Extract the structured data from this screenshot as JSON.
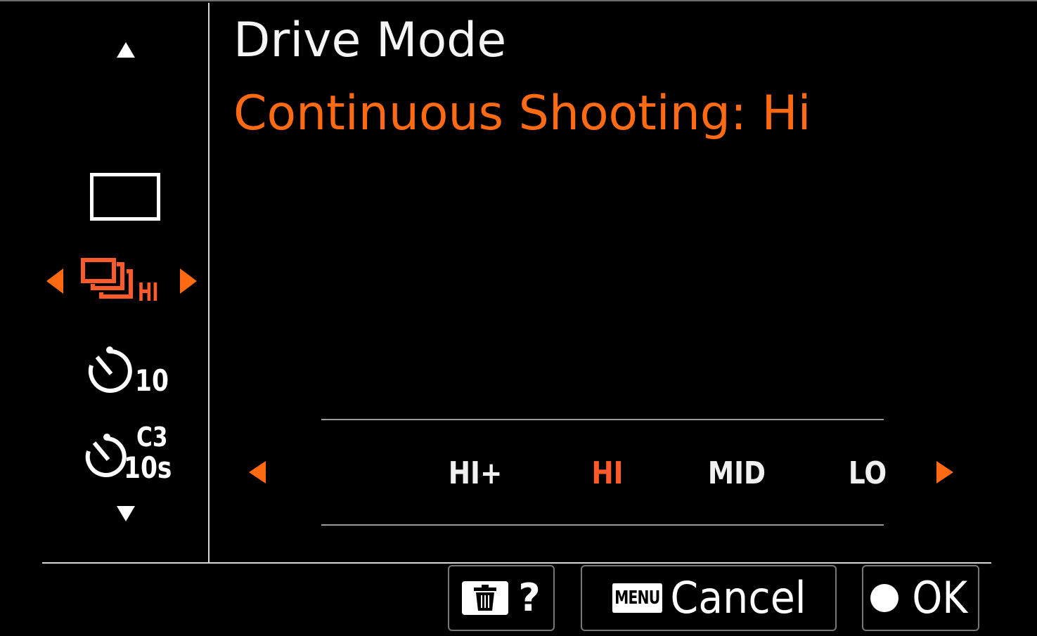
{
  "header": {
    "title": "Drive Mode",
    "selected_mode": "Continuous Shooting: Hi"
  },
  "left_menu": {
    "items": [
      {
        "icon": "single-shot-icon"
      },
      {
        "icon": "continuous-shooting-icon",
        "label": "HI",
        "selected": true
      },
      {
        "icon": "self-timer-icon",
        "label": "10"
      },
      {
        "icon": "self-timer-continuous-icon",
        "label_top": "C3",
        "label_bottom": "10s"
      }
    ]
  },
  "speed_options": {
    "items": [
      "HI+",
      "HI",
      "MID",
      "LO"
    ],
    "selected": "HI"
  },
  "buttons": {
    "help": "?",
    "menu_badge": "MENU",
    "cancel": "Cancel",
    "ok": "OK"
  },
  "colors": {
    "accent": "#ff6a13",
    "text": "#ffffff",
    "background": "#000000"
  }
}
